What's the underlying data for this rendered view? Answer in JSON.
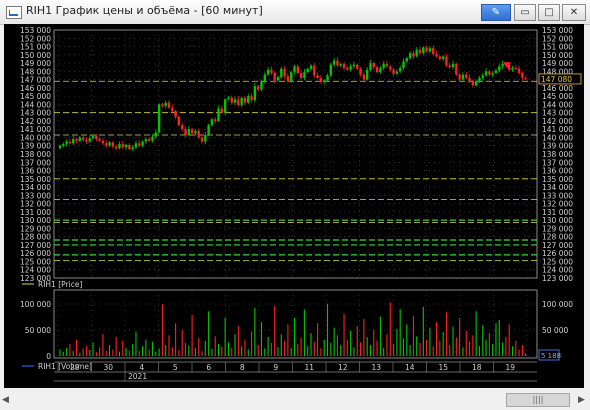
{
  "window": {
    "title": "RIH1 График цены и объёма - [60 минут]",
    "buttons": {
      "pin": "✎",
      "minimize": "▭",
      "maximize": "□",
      "close": "✕"
    }
  },
  "scrollbar": {
    "left_arrow": "◀",
    "right_arrow": "▶",
    "thumb": "||||"
  },
  "colors": {
    "background": "#000000",
    "up": "#00c800",
    "down": "#ff2020",
    "grid": "#5a5a5a",
    "level_green": "#39d639",
    "level_yellow": "#d8d84a",
    "current_price": "#e8c040",
    "volume_current": "#3a72ff"
  },
  "chart_data": [
    {
      "type": "candlestick",
      "legend": "RIH1 [Price]",
      "ylim": [
        123000,
        153000
      ],
      "y_ticks": [
        "153 000",
        "152 000",
        "151 000",
        "150 000",
        "149 000",
        "148 000",
        "147 000",
        "146 000",
        "145 000",
        "144 000",
        "143 000",
        "142 000",
        "141 000",
        "140 000",
        "139 000",
        "138 000",
        "137 000",
        "136 000",
        "135 000",
        "134 000",
        "133 000",
        "132 000",
        "131 000",
        "130 000",
        "129 000",
        "128 000",
        "127 000",
        "126 000",
        "125 000",
        "124 000",
        "123 000"
      ],
      "current_price": "147 080",
      "levels": [
        {
          "value": 146800,
          "color": "yellow"
        },
        {
          "value": 143000,
          "color": "yellow"
        },
        {
          "value": 140300,
          "color": "yellow"
        },
        {
          "value": 135000,
          "color": "yellow"
        },
        {
          "value": 132500,
          "color": "yellow"
        },
        {
          "value": 130000,
          "color": "green"
        },
        {
          "value": 129700,
          "color": "yellow"
        },
        {
          "value": 127600,
          "color": "green"
        },
        {
          "value": 127000,
          "color": "green"
        },
        {
          "value": 125800,
          "color": "green"
        },
        {
          "value": 125100,
          "color": "yellow"
        }
      ],
      "closes": [
        139000,
        139200,
        139500,
        139300,
        139800,
        139600,
        140000,
        139700,
        139500,
        139900,
        140200,
        139800,
        139600,
        139300,
        139000,
        139400,
        138900,
        138700,
        139200,
        138800,
        139100,
        138600,
        138800,
        139300,
        139000,
        139500,
        139800,
        139600,
        140100,
        140600,
        144000,
        143800,
        144200,
        143600,
        143200,
        142500,
        141500,
        141000,
        140300,
        141000,
        140500,
        140800,
        140000,
        139500,
        140300,
        141500,
        142200,
        142000,
        143500,
        143000,
        144600,
        144800,
        144200,
        144600,
        143900,
        144800,
        144200,
        145000,
        144500,
        146200,
        145800,
        146800,
        147600,
        148200,
        147800,
        146900,
        147300,
        148300,
        147400,
        146800,
        147900,
        148600,
        147800,
        147200,
        147900,
        148300,
        148700,
        147500,
        147200,
        146700,
        146900,
        147500,
        148800,
        149300,
        148700,
        148900,
        148400,
        148200,
        148600,
        148800,
        148300,
        147600,
        147000,
        148200,
        149000,
        148500,
        147900,
        148400,
        148900,
        148600,
        148200,
        147700,
        148000,
        148400,
        149200,
        149600,
        150200,
        149800,
        150600,
        150200,
        150900,
        150400,
        150800,
        150100,
        149800,
        149500,
        149800,
        148700,
        148500,
        148900,
        147600,
        147000,
        147600,
        147200,
        146800,
        146300,
        146800,
        147200,
        147500,
        148000,
        147600,
        147800,
        148100,
        148600,
        148900,
        148800,
        148200,
        148400,
        148300,
        147800,
        147200,
        147100
      ]
    },
    {
      "type": "bar",
      "legend": "RIH1 [Volume]",
      "y_ticks": [
        "100 000",
        "50 000",
        "0"
      ],
      "ylim": [
        0,
        110000
      ],
      "current_volume": "5 188",
      "x_labels": [
        "29",
        "30",
        "4",
        "5",
        "6",
        "8",
        "9",
        "11",
        "12",
        "13",
        "14",
        "15",
        "18",
        "19"
      ],
      "year_label": "2021",
      "volumes": [
        12000,
        8000,
        15000,
        22000,
        9000,
        30000,
        6000,
        14000,
        18000,
        11000,
        25000,
        7000,
        16000,
        40000,
        9000,
        20000,
        12000,
        35000,
        8000,
        28000,
        15000,
        10000,
        22000,
        45000,
        9000,
        18000,
        30000,
        12000,
        26000,
        8000,
        14000,
        95000,
        20000,
        38000,
        16000,
        60000,
        11000,
        48000,
        24000,
        19000,
        75000,
        15000,
        33000,
        9000,
        28000,
        82000,
        13000,
        36000,
        22000,
        17000,
        70000,
        25000,
        15000,
        40000,
        55000,
        18000,
        30000,
        12000,
        45000,
        88000,
        20000,
        62000,
        14000,
        35000,
        24000,
        92000,
        16000,
        40000,
        28000,
        58000,
        15000,
        70000,
        22000,
        34000,
        85000,
        18000,
        42000,
        26000,
        60000,
        14000,
        30000,
        96000,
        24000,
        52000,
        38000,
        20000,
        78000,
        30000,
        46000,
        16000,
        55000,
        25000,
        68000,
        35000,
        20000,
        48000,
        28000,
        72000,
        15000,
        40000,
        98000,
        22000,
        50000,
        86000,
        32000,
        58000,
        20000,
        74000,
        36000,
        24000,
        90000,
        30000,
        52000,
        18000,
        62000,
        28000,
        44000,
        80000,
        20000,
        54000,
        34000,
        70000,
        16000,
        46000,
        26000,
        38000,
        82000,
        18000,
        56000,
        30000,
        42000,
        22000,
        60000,
        66000,
        25000,
        35000,
        58000,
        18000,
        28000,
        12000,
        20000,
        5188
      ]
    }
  ]
}
